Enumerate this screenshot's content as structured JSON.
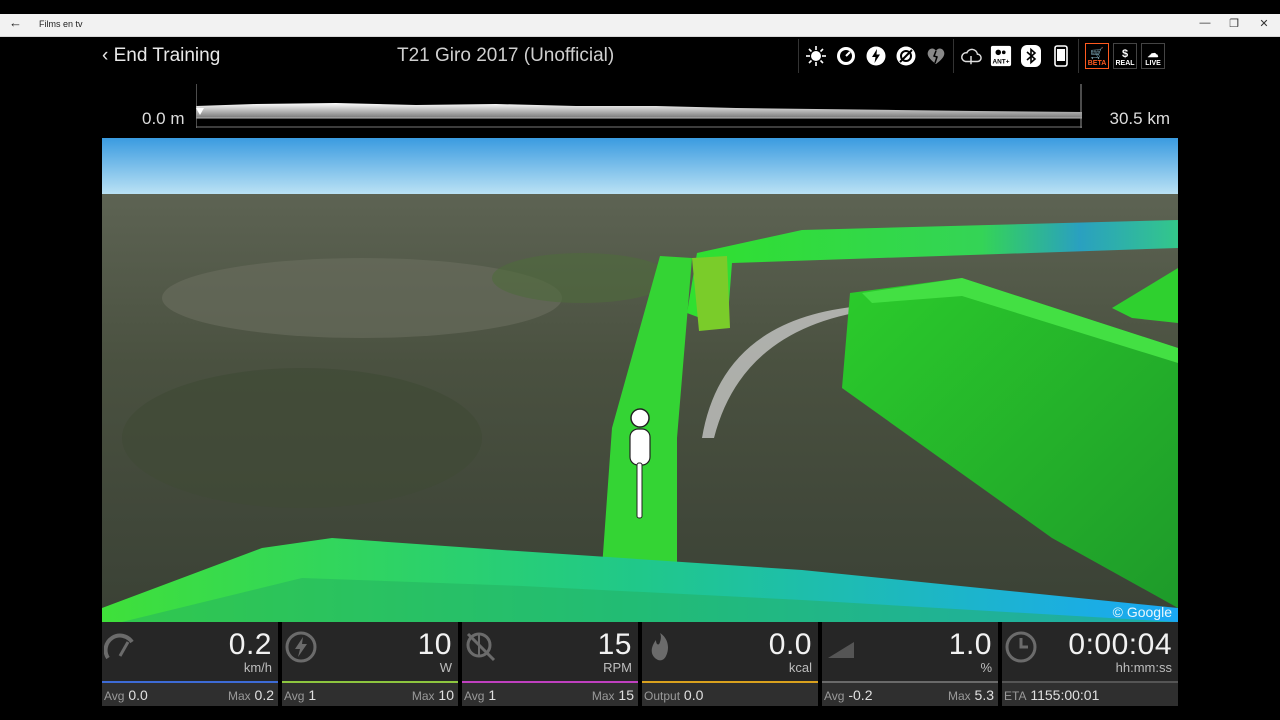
{
  "window": {
    "title": "Films en tv",
    "back": "←",
    "minimize": "—",
    "restore": "❐",
    "close": "✕"
  },
  "header": {
    "end_training": "‹ End Training",
    "workout_title": "T21 Giro 2017 (Unofficial)"
  },
  "toolbar": {
    "icons": [
      "sun-icon",
      "speed-gauge-icon",
      "power-icon",
      "cadence-icon",
      "heart-icon",
      "cloud-icon",
      "ant-plus-icon",
      "bluetooth-icon",
      "phone-icon"
    ],
    "ant_label": "ANT+",
    "badges": {
      "beta": "BETA",
      "real": "REAL",
      "live": "LIVE"
    }
  },
  "elevation": {
    "start": "0.0 m",
    "end": "30.5 km",
    "progress_fraction": 0.0
  },
  "map": {
    "attribution": "© Google"
  },
  "stats": {
    "speed": {
      "value": "0.2",
      "unit": "km/h",
      "avg_label": "Avg",
      "avg": "0.0",
      "max_label": "Max",
      "max": "0.2"
    },
    "power": {
      "value": "10",
      "unit": "W",
      "avg_label": "Avg",
      "avg": "1",
      "max_label": "Max",
      "max": "10"
    },
    "cadence": {
      "value": "15",
      "unit": "RPM",
      "avg_label": "Avg",
      "avg": "1",
      "max_label": "Max",
      "max": "15"
    },
    "energy": {
      "value": "0.0",
      "unit": "kcal",
      "output_label": "Output",
      "output": "0.0"
    },
    "grade": {
      "value": "1.0",
      "unit": "%",
      "avg_label": "Avg",
      "avg": "-0.2",
      "max_label": "Max",
      "max": "5.3"
    },
    "time": {
      "value": "0:00:04",
      "unit": "hh:mm:ss",
      "eta_label": "ETA",
      "eta": "1155:00:01"
    }
  },
  "colors": {
    "speed": "#3d6bd6",
    "power": "#8dc63f",
    "cadence": "#c040c0",
    "energy": "#d9a11e",
    "grade": "#6a6a6a",
    "time": "#555555",
    "route_green": "#2ee02e",
    "route_blue": "#1aa3ff"
  }
}
